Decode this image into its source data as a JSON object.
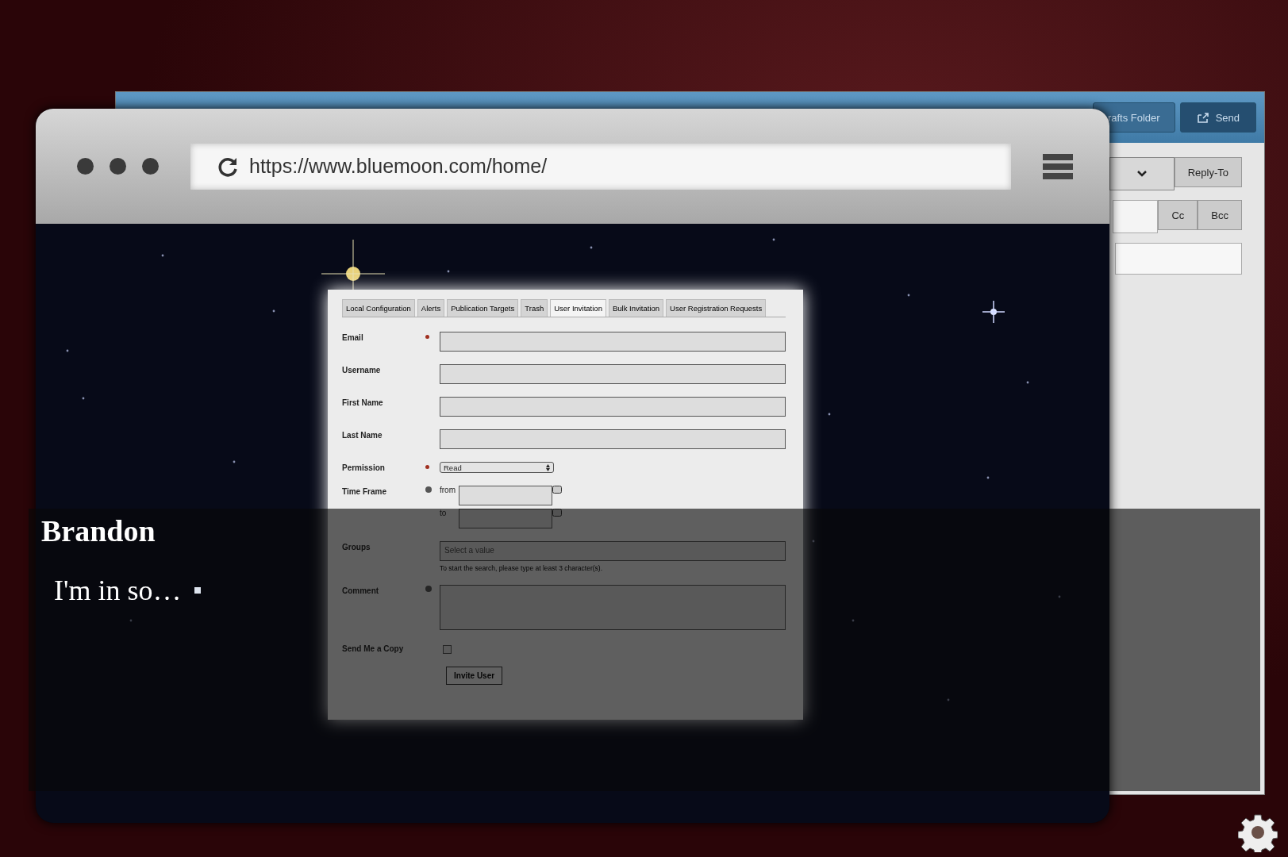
{
  "email_window": {
    "header_buttons": [
      {
        "label": "rafts Folder",
        "kind": "plain"
      },
      {
        "label": "Send",
        "kind": "send"
      }
    ],
    "reply_to": "Reply-To",
    "cc": "Cc",
    "bcc": "Bcc"
  },
  "browser": {
    "url": "https://www.bluemoon.com/home/"
  },
  "form": {
    "tabs": [
      {
        "label": "Local Configuration",
        "selected": false
      },
      {
        "label": "Alerts",
        "selected": false
      },
      {
        "label": "Publication Targets",
        "selected": false
      },
      {
        "label": "Trash",
        "selected": false
      },
      {
        "label": "User Invitation",
        "selected": true
      },
      {
        "label": "Bulk Invitation",
        "selected": false
      },
      {
        "label": "User Registration Requests",
        "selected": false
      }
    ],
    "fields": [
      {
        "kind": "text",
        "label": "Email",
        "required": true,
        "info": false
      },
      {
        "kind": "text",
        "label": "Username",
        "required": false,
        "info": false
      },
      {
        "kind": "text",
        "label": "First Name",
        "required": false,
        "info": false
      },
      {
        "kind": "text",
        "label": "Last Name",
        "required": false,
        "info": false
      },
      {
        "kind": "select",
        "label": "Permission",
        "required": true,
        "info": false,
        "value": "Read"
      },
      {
        "kind": "daterange",
        "label": "Time Frame",
        "required": false,
        "info": true,
        "from": "from",
        "to": "to"
      },
      {
        "kind": "search",
        "label": "Groups",
        "required": false,
        "info": false,
        "placeholder": "Select a value",
        "hint": "To start the search, please type at least 3 character(s)."
      },
      {
        "kind": "textarea",
        "label": "Comment",
        "required": false,
        "info": true
      },
      {
        "kind": "checkbox",
        "label": "Send Me a Copy",
        "required": false,
        "info": false,
        "checked": false
      }
    ],
    "submit": "Invite User"
  },
  "dialogue": {
    "speaker": "Brandon",
    "text": "I'm in so…"
  }
}
